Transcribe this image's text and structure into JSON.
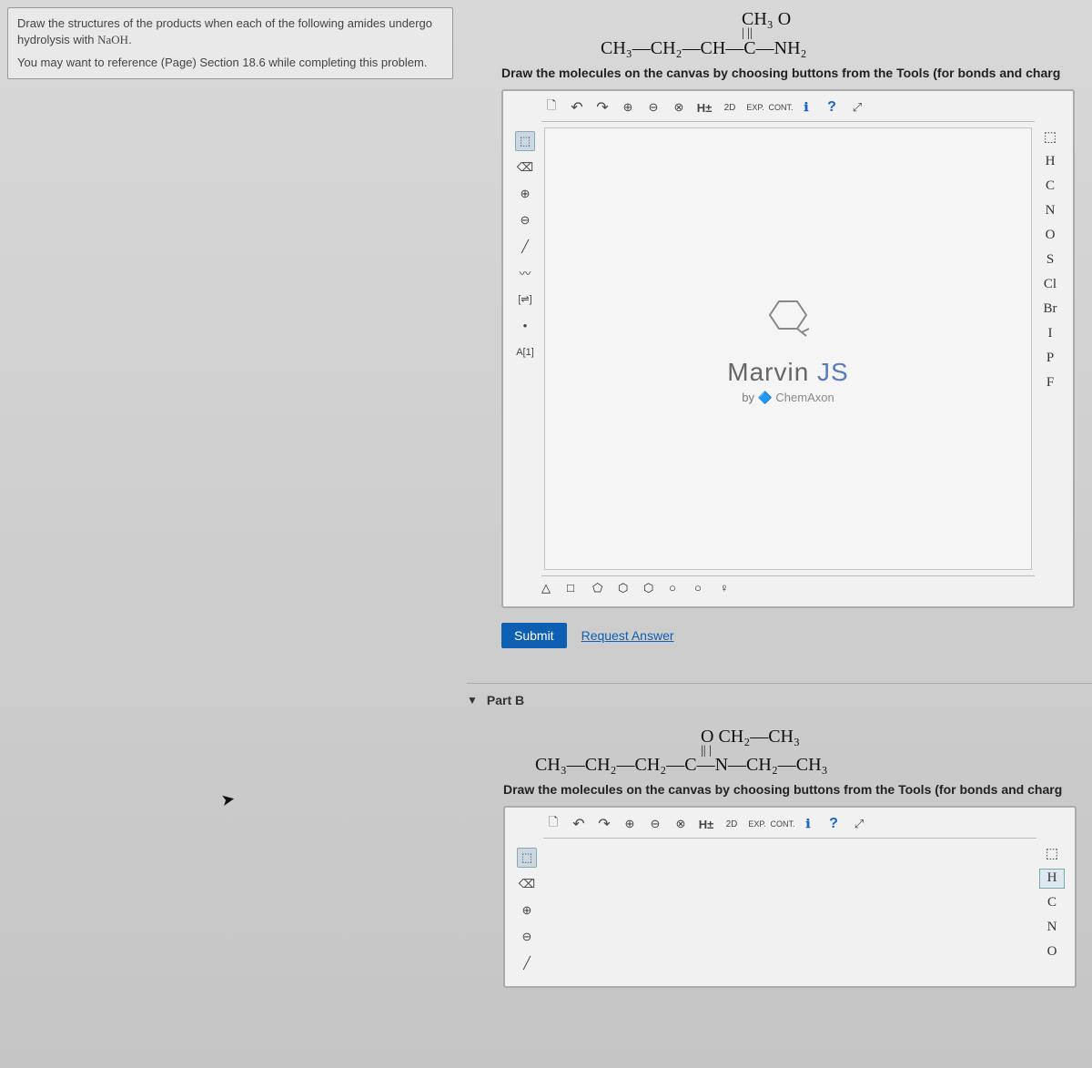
{
  "leftbox": {
    "p1a": "Draw the structures of the products when each of the following amides undergo hydrolysis with ",
    "p1b": "NaOH",
    "p1c": ".",
    "p2": "You may want to reference (Page) Section 18.6 while completing this problem."
  },
  "partA": {
    "formula_top": "CH₃   O",
    "formula_mid": "  |       ||",
    "formula_bot": "CH₃—CH₂—CH—C—NH₂",
    "instruction": "Draw the molecules on the canvas by choosing buttons from the Tools (for bonds and charg",
    "logo1": "Marvin",
    "logo2": "JS",
    "by": "by",
    "chemaxon": "ChemAxon"
  },
  "toolbar": {
    "top": [
      "🗋",
      "↶",
      "↷",
      "⊕",
      "⊖",
      "⊗",
      "H±",
      "2D",
      "EXP.",
      "CONT.",
      "ℹ",
      "?",
      "⤢"
    ],
    "left": [
      "⬚",
      "⌫",
      "⊕",
      "⊖",
      "╱",
      "〰",
      "[⇌]",
      "•",
      "A[1]"
    ],
    "right": [
      "⬚",
      "H",
      "C",
      "N",
      "O",
      "S",
      "Cl",
      "Br",
      "I",
      "P",
      "F"
    ],
    "bottom_shapes": [
      "△",
      "□",
      "⬠",
      "⬡",
      "⬡",
      "○",
      "○",
      "♀"
    ]
  },
  "submit": {
    "btn": "Submit",
    "req": "Request Answer"
  },
  "partB": {
    "title": "Part B",
    "formula_top": "O     CH₂—CH₃",
    "formula_mid": "||       |",
    "formula_bot": "CH₃—CH₂—CH₂—C—N—CH₂—CH₃",
    "instruction": "Draw the molecules on the canvas by choosing buttons from the Tools (for bonds and charg"
  },
  "right2": [
    "⬚",
    "H",
    "C",
    "N",
    "O"
  ]
}
